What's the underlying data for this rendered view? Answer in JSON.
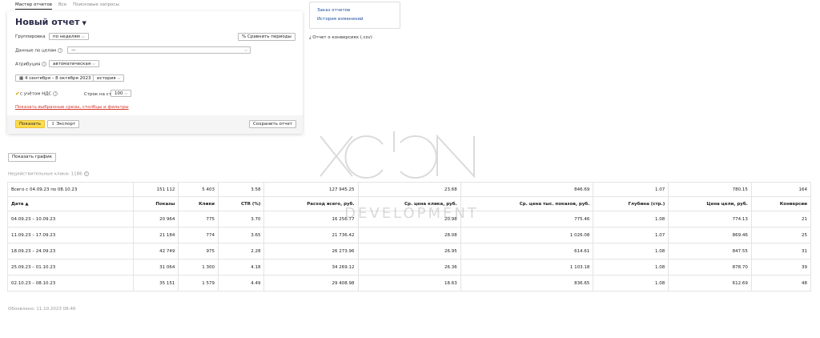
{
  "tabs": [
    "Мастер отчетов",
    "Все",
    "Поисковые запросы"
  ],
  "report": {
    "title": "Новый отчет",
    "grouping_label": "Группировка",
    "grouping_value": "по неделям",
    "compare_label": "Сравнить периоды",
    "goals_label": "Данные по целям",
    "goals_value": "—",
    "attribution_label": "Атрибуция",
    "attribution_value": "автоматическая",
    "date_range": "4 сентября – 8 октября 2023",
    "history_value": "история",
    "vat_label": "с учётом НДС",
    "rows_label": "Строк на странице",
    "rows_value": "100",
    "show_selected_link": "Показать выбранные срезы, столбцы и фильтры",
    "show_button": "Показать",
    "export_button": "Экспорт",
    "save_button": "Сохранить отчет"
  },
  "side": {
    "order_reports": "Заказ отчетов",
    "change_history": "История изменений",
    "csv_link": "Отчет о конверсиях (.csv)"
  },
  "graph_button": "Показать график",
  "inconclusive": "Недействительные клики: 1186",
  "watermark": "DEVELOPMENT",
  "table": {
    "total": [
      "Всего с 04.09.23 по 08.10.23",
      "151 112",
      "5 403",
      "3.58",
      "127 945.25",
      "23.68",
      "846.69",
      "1.07",
      "780.15",
      "164"
    ],
    "headers": [
      "Дата ▲",
      "Показы",
      "Клики",
      "CTR (%)",
      "Расход всего, руб.",
      "Ср. цена клика, руб.",
      "Ср. цена тыс. показов, руб.",
      "Глубина (стр.)",
      "Цена цели, руб.",
      "Конверсии"
    ],
    "rows": [
      [
        "04.09.23 – 10.09.23",
        "20 964",
        "775",
        "3.70",
        "16 256.77",
        "20.98",
        "775.46",
        "1.08",
        "774.13",
        "21"
      ],
      [
        "11.09.23 – 17.09.23",
        "21 184",
        "774",
        "3.65",
        "21 736.42",
        "28.08",
        "1 026.08",
        "1.07",
        "869.46",
        "25"
      ],
      [
        "18.09.23 – 24.09.23",
        "42 749",
        "975",
        "2.28",
        "26 273.96",
        "26.95",
        "614.61",
        "1.08",
        "847.55",
        "31"
      ],
      [
        "25.09.23 – 01.10.23",
        "31 064",
        "1 300",
        "4.18",
        "34 269.12",
        "26.36",
        "1 103.18",
        "1.08",
        "878.70",
        "39"
      ],
      [
        "02.10.23 – 08.10.23",
        "35 151",
        "1 579",
        "4.49",
        "29 408.98",
        "18.63",
        "836.65",
        "1.08",
        "612.69",
        "48"
      ]
    ]
  },
  "updated": "Обновлено: 11.10.2023 08:46"
}
